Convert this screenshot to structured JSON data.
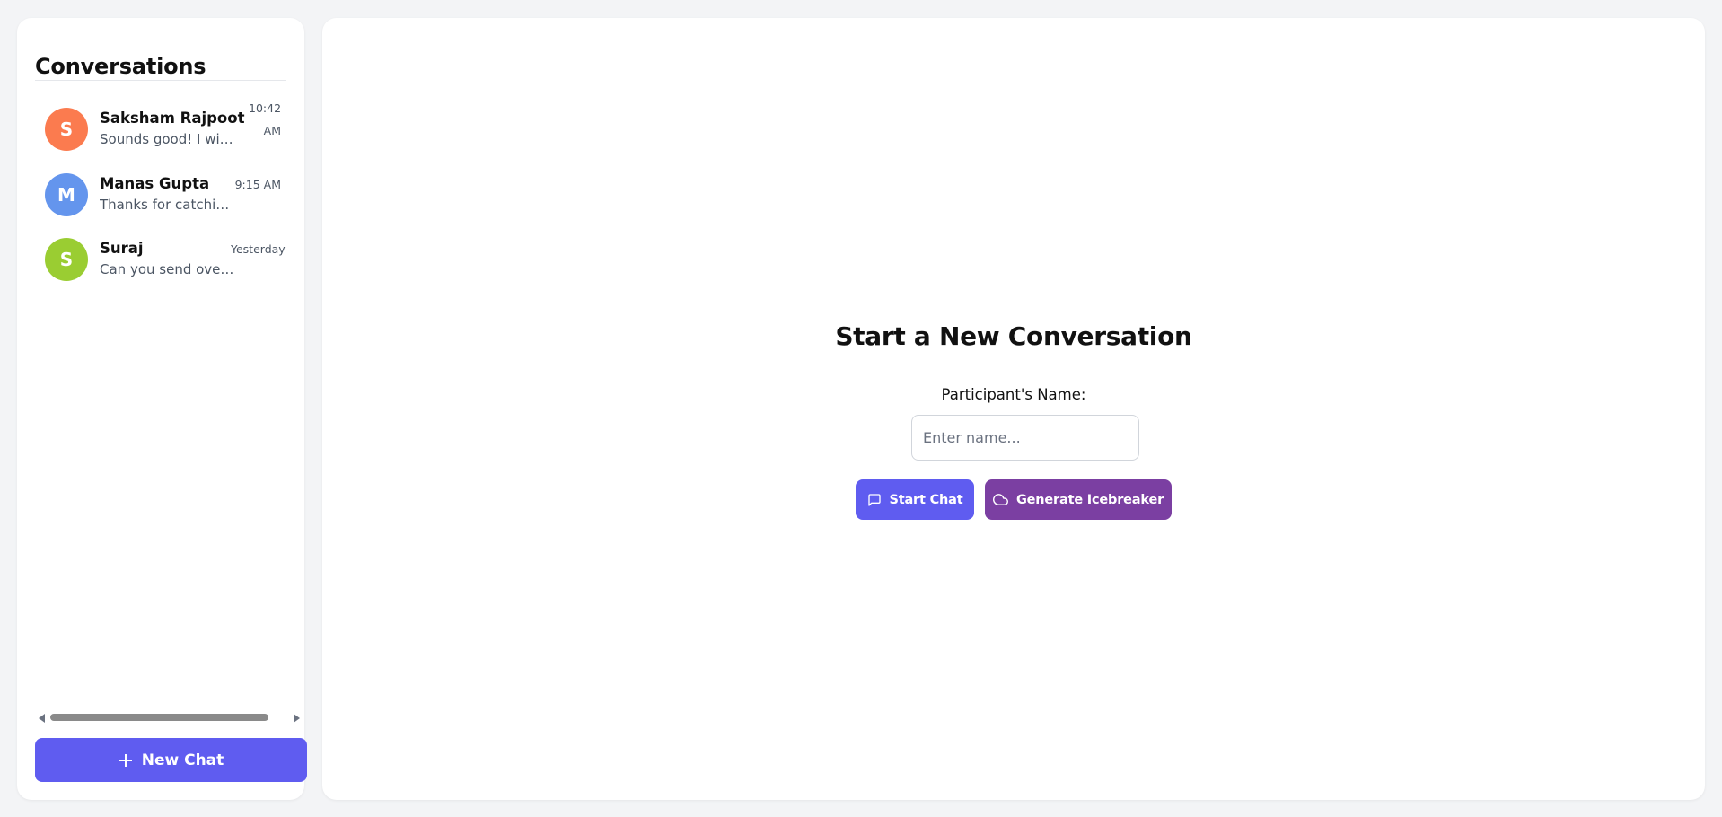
{
  "sidebar": {
    "title": "Conversations",
    "conversations": [
      {
        "initial": "S",
        "name": "Saksham Rajpoot",
        "preview": "Sounds good! I will c...",
        "time_line1": "10:42",
        "time_line2": "AM",
        "avatar_color": "#fb7b4f"
      },
      {
        "initial": "M",
        "name": "Manas Gupta",
        "preview": "Thanks for catching...",
        "time_line1": "9:15 AM",
        "time_line2": "",
        "avatar_color": "#6495ed"
      },
      {
        "initial": "S",
        "name": "Suraj",
        "preview": "Can you send over t...",
        "time_line1": "Yesterday",
        "time_line2": "",
        "avatar_color": "#9acd32"
      }
    ],
    "new_chat_label": "New Chat"
  },
  "main": {
    "title": "Start a New Conversation",
    "name_label": "Participant's Name:",
    "name_placeholder": "Enter name...",
    "name_value": "",
    "start_chat_label": "Start Chat",
    "icebreaker_label": "Generate Icebreaker"
  },
  "colors": {
    "primary": "#5f5cf0",
    "icebreaker": "#7b3fa2",
    "background": "#f3f4f6"
  },
  "icons": {
    "new_chat": "plus-icon",
    "start_chat": "message-square-icon",
    "icebreaker": "cloud-icon",
    "scroll_left": "arrow-left-icon",
    "scroll_right": "arrow-right-icon"
  }
}
